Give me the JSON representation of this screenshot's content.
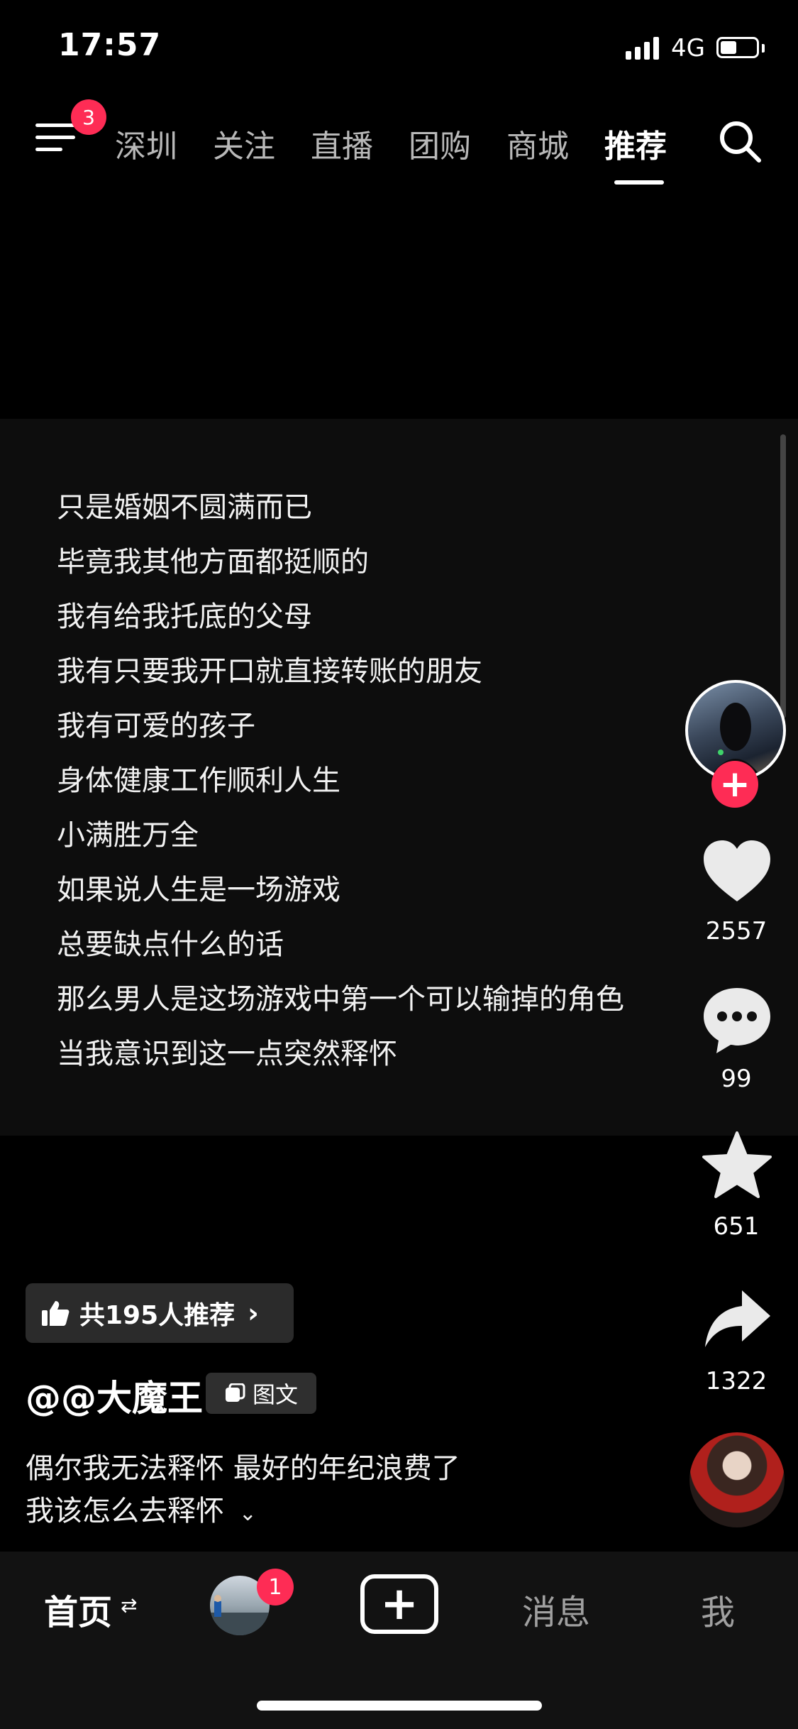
{
  "status_bar": {
    "time": "17:57",
    "network": "4G",
    "battery_level": 0.45
  },
  "top_nav": {
    "menu_badge": "3",
    "tabs": [
      {
        "label": "深圳",
        "active": false
      },
      {
        "label": "关注",
        "active": false
      },
      {
        "label": "直播",
        "active": false
      },
      {
        "label": "团购",
        "active": false
      },
      {
        "label": "商城",
        "active": false
      },
      {
        "label": "推荐",
        "active": true
      }
    ],
    "search_icon": "search-icon"
  },
  "post": {
    "lines": [
      "只是婚姻不圆满而已",
      "毕竟我其他方面都挺顺的",
      "我有给我托底的父母",
      "我有只要我开口就直接转账的朋友",
      "我有可爱的孩子",
      "身体健康工作顺利人生",
      "小满胜万全",
      "如果说人生是一场游戏",
      "总要缺点什么的话",
      "那么男人是这场游戏中第一个可以输掉的角色",
      "当我意识到这一点突然释怀"
    ]
  },
  "actions": {
    "follow_symbol": "+",
    "likes": "2557",
    "comments": "99",
    "favorites": "651",
    "shares": "1322"
  },
  "info": {
    "recommend_label": "共195人推荐",
    "author": "@@大魔王",
    "type_badge": "图文",
    "description_line1": "偶尔我无法释怀  最好的年纪浪费了",
    "description_line2": "我该怎么去释怀"
  },
  "bottom_nav": {
    "home": "首页",
    "friend_badge": "1",
    "add_symbol": "+",
    "messages": "消息",
    "me": "我"
  },
  "colors": {
    "accent": "#fe2c55",
    "background": "#000000"
  }
}
